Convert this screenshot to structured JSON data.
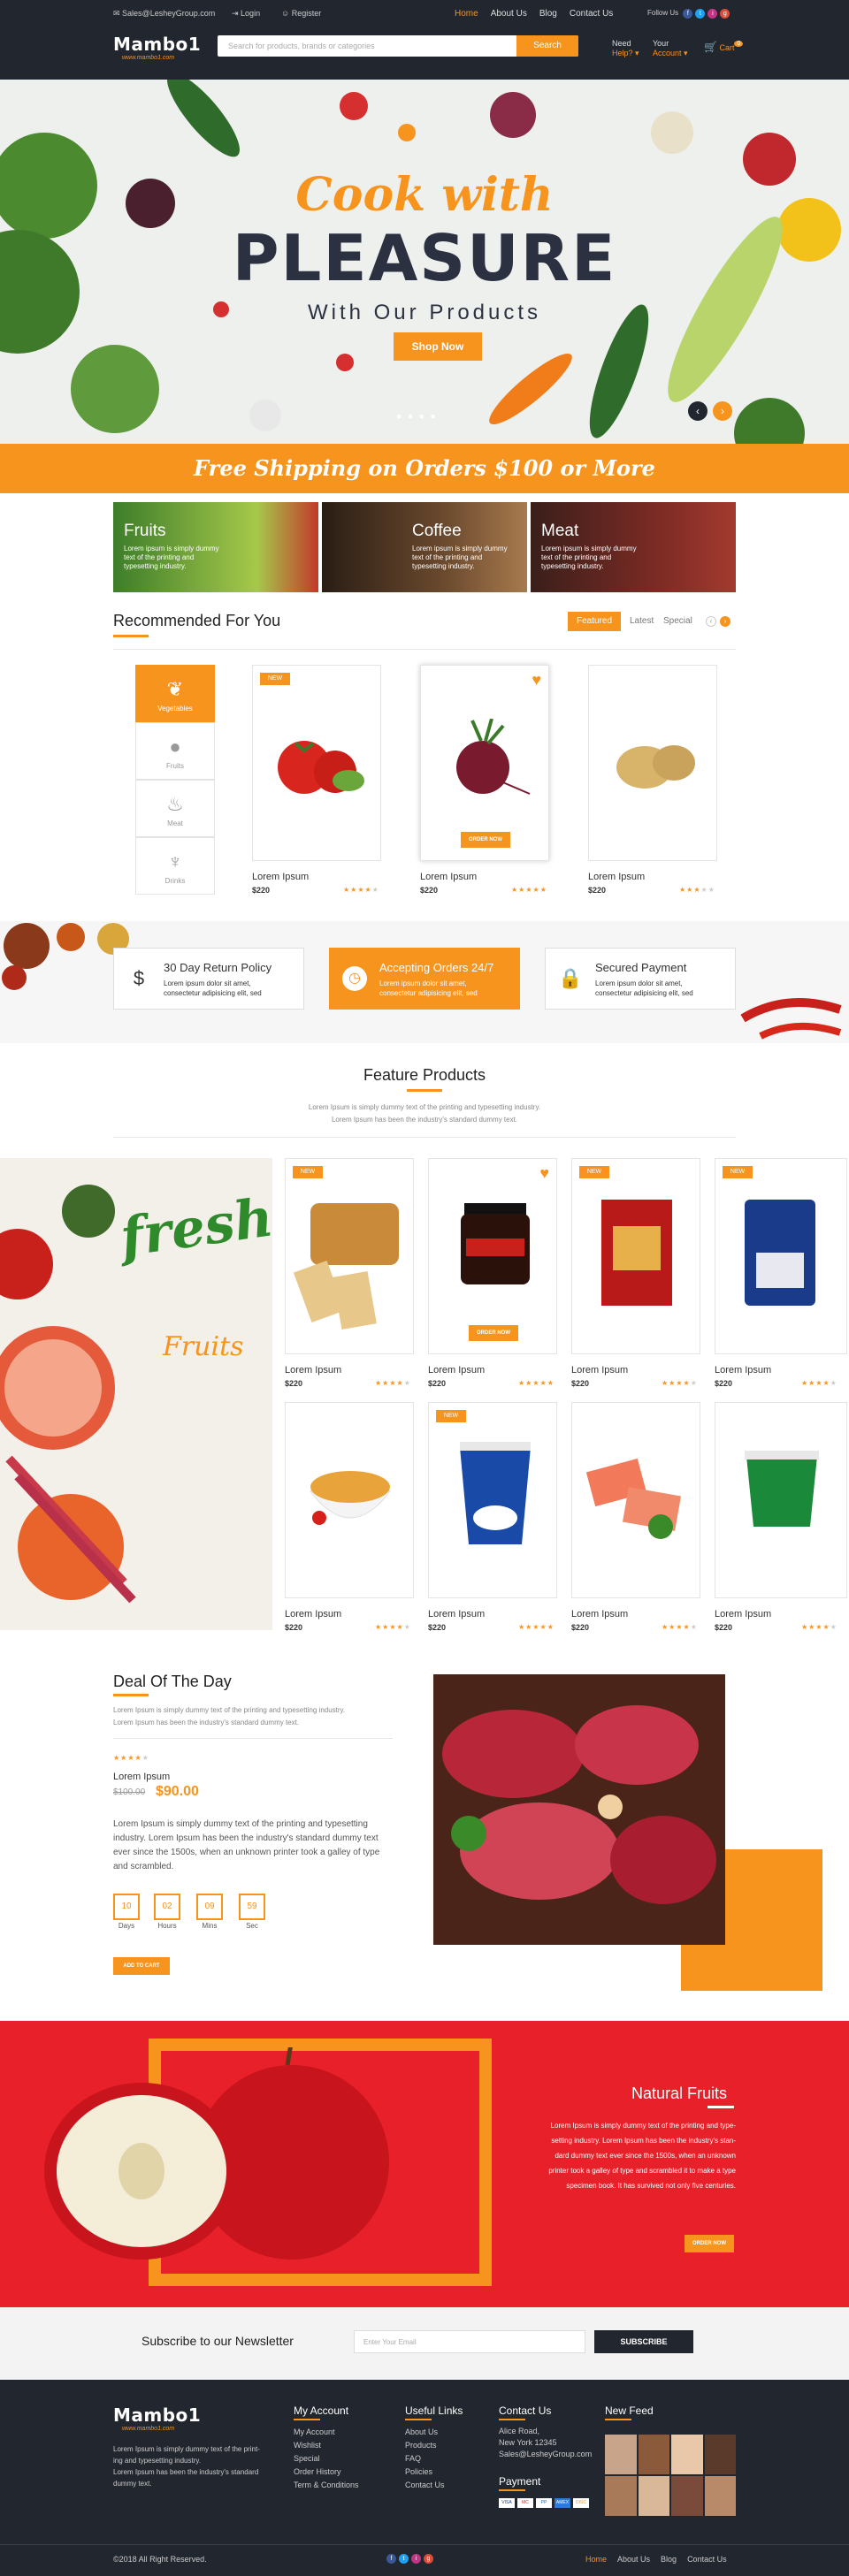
{
  "header": {
    "email": "Sales@LesheyGroup.com",
    "login": "Login",
    "register": "Register",
    "nav": [
      "Home",
      "About Us",
      "Blog",
      "Contact Us"
    ],
    "follow_us": "Follow Us",
    "logo": "Mambo1",
    "logo_tagline": "www.mambo1.com",
    "search_placeholder": "Search for products, brands or categories",
    "search_button": "Search",
    "need_help_top": "Need",
    "need_help_bottom": "Help?",
    "account_top": "Your",
    "account_bottom": "Account",
    "cart": "Cart",
    "cart_count": "0"
  },
  "hero": {
    "line1": "Cook with",
    "line2": "PLEASURE",
    "line3": "With Our Products",
    "button": "Shop Now",
    "prev": "‹",
    "next": "›"
  },
  "free_shipping": "Free Shipping on Orders $100 or More",
  "categories": [
    {
      "title": "Fruits",
      "text": "Lorem ipsum is simply dummy text of the printing and typesetting industry."
    },
    {
      "title": "Coffee",
      "text": "Lorem ipsum is simply dummy text of the printing and typesetting industry."
    },
    {
      "title": "Meat",
      "text": "Lorem ipsum is simply dummy text of the printing and typesetting industry."
    }
  ],
  "recommended": {
    "title": "Recommended For You",
    "tabs": [
      "Featured",
      "Latest",
      "Special"
    ],
    "side_categories": [
      "Vegetables",
      "Fruits",
      "Meat",
      "Drinks"
    ],
    "products": [
      {
        "name": "Lorem Ipsum",
        "price": "$220",
        "badge": "NEW",
        "rating": 4
      },
      {
        "name": "Lorem Ipsum",
        "price": "$220",
        "button": "ORDER NOW",
        "rating": 5
      },
      {
        "name": "Lorem Ipsum",
        "price": "$220",
        "rating": 3
      }
    ]
  },
  "services": [
    {
      "title": "30 Day Return Policy",
      "text1": "Lorem ipsum dolor sit amet,",
      "text2": "consectetur adipisicing elit, sed"
    },
    {
      "title": "Accepting Orders 24/7",
      "text1": "Lorem ipsum dolor sit amet,",
      "text2": "consectetur adipisicing elit, sed"
    },
    {
      "title": "Secured Payment",
      "text1": "Lorem ipsum dolor sit amet,",
      "text2": "consectetur adipisicing elit, sed"
    }
  ],
  "feature": {
    "title": "Feature Products",
    "desc1": "Lorem Ipsum is simply dummy text of the printing and typesetting industry.",
    "desc2": "Lorem Ipsum has been the industry's standard dummy text.",
    "fresh": "fresh",
    "fruits": "Fruits",
    "products": [
      {
        "name": "Lorem Ipsum",
        "price": "$220",
        "badge": "NEW",
        "rating": 4
      },
      {
        "name": "Lorem Ipsum",
        "price": "$220",
        "button": "ORDER NOW",
        "rating": 5
      },
      {
        "name": "Lorem Ipsum",
        "price": "$220",
        "badge": "NEW",
        "rating": 4
      },
      {
        "name": "Lorem Ipsum",
        "price": "$220",
        "badge": "NEW",
        "rating": 4
      },
      {
        "name": "Lorem Ipsum",
        "price": "$220",
        "rating": 4
      },
      {
        "name": "Lorem Ipsum",
        "price": "$220",
        "badge": "NEW",
        "rating": 5
      },
      {
        "name": "Lorem Ipsum",
        "price": "$220",
        "rating": 4
      },
      {
        "name": "Lorem Ipsum",
        "price": "$220",
        "rating": 4
      }
    ]
  },
  "deal": {
    "title": "Deal Of The Day",
    "desc1": "Lorem Ipsum is simply dummy text of the printing and typesetting industry.",
    "desc2": "Lorem Ipsum has been the industry's standard dummy text.",
    "product": "Lorem Ipsum",
    "old_price": "$100.00",
    "new_price": "$90.00",
    "long1": "Lorem Ipsum is simply dummy text of the printing and typesetting",
    "long2": "industry. Lorem Ipsum has been the industry's standard dummy text",
    "long3": "ever since the 1500s, when an unknown printer took a galley of type",
    "long4": "and scrambled.",
    "timer": [
      {
        "value": "10",
        "label": "Days"
      },
      {
        "value": "02",
        "label": "Hours"
      },
      {
        "value": "09",
        "label": "Mins"
      },
      {
        "value": "59",
        "label": "Sec"
      }
    ],
    "button": "ADD TO CART",
    "rating": 4
  },
  "natural": {
    "title": "Natural Fruits",
    "l1": "Lorem Ipsum is simply dummy text of the printing and type-",
    "l2": "setting industry. Lorem Ipsum has been the industry's stan-",
    "l3": "dard dummy text ever since the 1500s, when an unknown",
    "l4": "printer took a galley of type and scrambled it to make a type",
    "l5": "specimen book. It has survived not only five centuries.",
    "button": "ORDER NOW"
  },
  "newsletter": {
    "title": "Subscribe to our Newsletter",
    "placeholder": "Enter Your Email",
    "button": "SUBSCRIBE"
  },
  "footer": {
    "logo": "Mambo1",
    "logo_tagline": "www.mambo1.com",
    "about": [
      "Lorem Ipsum is simply dummy text of the print-",
      "ing and typesetting industry.",
      "Lorem Ipsum has been the industry's standard",
      "dummy text."
    ],
    "account_title": "My Account",
    "account_links": [
      "My Account",
      "Wishlist",
      "Special",
      "Order History",
      "Term & Conditions"
    ],
    "useful_title": "Useful Links",
    "useful_links": [
      "About Us",
      "Products",
      "FAQ",
      "Policies",
      "Contact Us"
    ],
    "contact_title": "Contact Us",
    "contact_lines": [
      "Alice Road,",
      "New York 12345",
      "Sales@LesheyGroup.com"
    ],
    "payment_title": "Payment",
    "payments": [
      "VISA",
      "MC",
      "PP",
      "AMEX",
      "DISC"
    ],
    "feed_title": "New Feed",
    "copyright": "©2018 All Right Reserved.",
    "nav": [
      "Home",
      "About Us",
      "Blog",
      "Contact Us"
    ]
  },
  "colors": {
    "accent": "#f7941d",
    "dark": "#22262f",
    "red": "#e8202a"
  }
}
